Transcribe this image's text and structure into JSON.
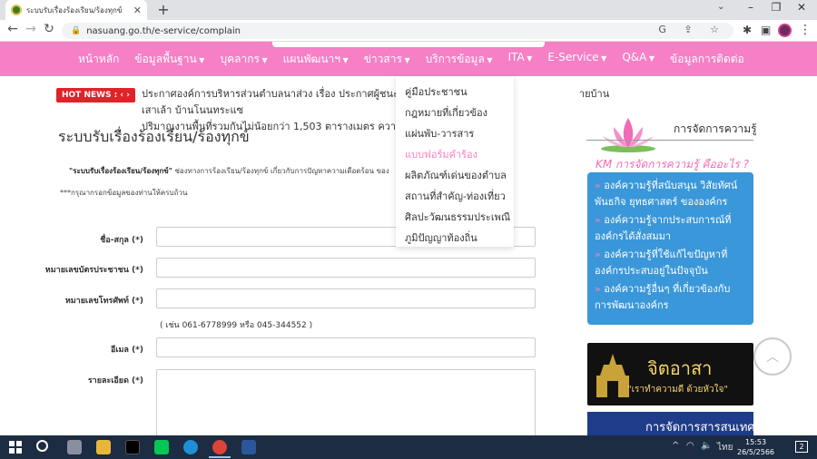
{
  "browser": {
    "tab_title": "ระบบรับเรื่องร้องเรียน/ร้องทุกข์",
    "url": "nasuang.go.th/e-service/complain"
  },
  "nav": {
    "items": [
      {
        "label": "หน้าหลัก",
        "caret": false
      },
      {
        "label": "ข้อมูลพื้นฐาน",
        "caret": true
      },
      {
        "label": "บุคลากร",
        "caret": true
      },
      {
        "label": "แผนพัฒนาฯ",
        "caret": true
      },
      {
        "label": "ข่าวสาร",
        "caret": true
      },
      {
        "label": "บริการข้อมูล",
        "caret": true
      },
      {
        "label": "ITA",
        "caret": true
      },
      {
        "label": "E-Service",
        "caret": true
      },
      {
        "label": "Q&A",
        "caret": true
      },
      {
        "label": "ข้อมูลการติดต่อ",
        "caret": false
      }
    ]
  },
  "dropdown": {
    "items": [
      "คู่มือประชาชน",
      "กฎหมายที่เกี่ยวข้อง",
      "แผ่นพับ-วารสาร",
      "แบบฟอร์มคำร้อง",
      "ผลิตภัณฑ์เด่นของตำบล",
      "สถานที่สำคัญ-ท่องเที่ยว",
      "ศิลปะวัฒนธรรมประเพณี",
      "ภูมิปัญญาท้องถิ่น"
    ],
    "active_index": 3
  },
  "hotnews": {
    "label": "HOT NEWS :",
    "line1": "ประกาศองค์การบริหารส่วนตำบลนาส่วง เรื่อง ประกาศผู้ชนะการเสนอราคา",
    "line1_tail": "ายบ้านเสาเล้า บ้านโนนทระแซ",
    "line2": "ปริมาณงานพื้นที่รวมกันไม่น้อยกว่า 1,503 ตารางเมตร ความหนาเฉลี่ย"
  },
  "page": {
    "title": "ระบบรับเรื่องร้องเรียน/ร้องทุกข์",
    "intro_bold": "\"ระบบรับเรื่องร้องเรียน/ร้องทุกข์\"",
    "intro_rest": " ช่องทางการร้องเรียน/ร้องทุกข์ เกี่ยวกับการปัญหาความเดือดร้อน ของ",
    "note": "***กรุณากรอกข้อมูลของท่านให้ครบถ้วน",
    "phone_hint": "( เช่น 061-6778999 หรือ 045-344552 )"
  },
  "form": {
    "name_label": "ชื่อ-สกุล (*)",
    "id_label": "หมายเลขบัตรประชาชน (*)",
    "phone_label": "หมายเลขโทรศัพท์ (*)",
    "email_label": "อีเมล (*)",
    "detail_label": "รายละเอียด (*)"
  },
  "sidebar": {
    "km_title": "การจัดการความรู้",
    "km_subtitle": "KM การจัดการความรู้ คืออะไร ?",
    "km_links": [
      "องค์ความรู้ที่สนับสนุน วิสัยทัศน์ พันธกิจ ยุทธศาสตร์ ขององค์กร",
      "องค์ความรู้จากประสบการณ์ที่องค์กรได้สั่งสมมา",
      "องค์ความรู้ที่ใช้แก้ไขปัญหาที่องค์กรประสบอยู่ในปัจจุบัน",
      "องค์ความรู้อื่นๆ ที่เกี่ยวข้องกับการพัฒนาองค์กร"
    ],
    "banner1_main": "จิตอาสา",
    "banner1_sub": "\"เราทำความดี ด้วยหัวใจ\"",
    "banner2_text": "การจัดการสารสนเทศ"
  },
  "taskbar": {
    "language": "ไทย",
    "time": "15:53",
    "date": "26/5/2566",
    "notifications": "2"
  },
  "colors": {
    "nav_pink": "#f67fc6",
    "hotnews_red": "#e0232a",
    "km_blue": "#3a97d9",
    "taskbar": "#1c2c42"
  }
}
